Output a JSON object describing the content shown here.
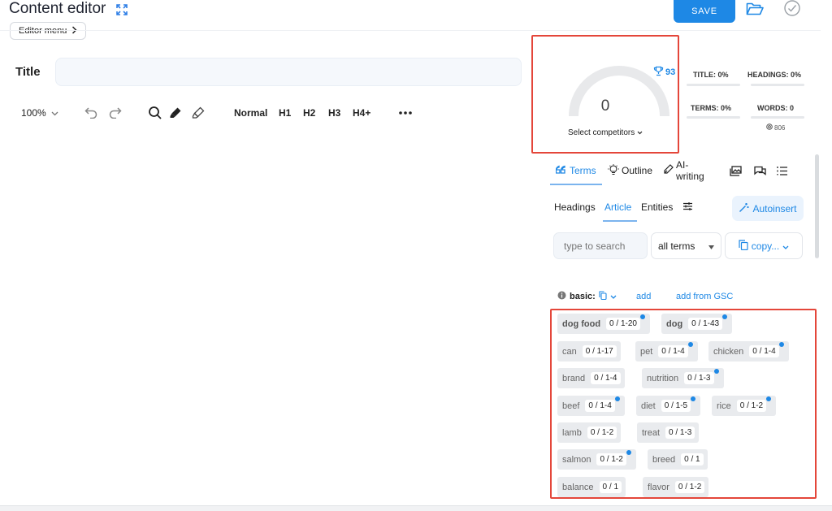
{
  "header": {
    "title": "Content editor",
    "editor_menu": "Editor menu",
    "save_label": "SAVE"
  },
  "editor": {
    "title_label": "Title",
    "title_value": "",
    "zoom": "100%",
    "formats": [
      "Normal",
      "H1",
      "H2",
      "H3",
      "H4+"
    ]
  },
  "score": {
    "value": "0",
    "select_competitors": "Select competitors",
    "target": "93",
    "metrics": {
      "title": "TITLE: 0%",
      "headings": "HEADINGS: 0%",
      "terms": "TERMS: 0%",
      "words": "WORDS: 0",
      "words_target": "806"
    }
  },
  "tabs": {
    "terms": "Terms",
    "outline": "Outline",
    "ai_writing": "AI-writing"
  },
  "subtabs": {
    "headings": "Headings",
    "article": "Article",
    "entities": "Entities",
    "autoinsert": "Autoinsert"
  },
  "filters": {
    "search_placeholder": "type to search",
    "terms_select": "all terms",
    "copy": "copy..."
  },
  "basic": {
    "label": "basic:",
    "add": "add",
    "add_gsc": "add from GSC"
  },
  "terms": [
    {
      "name": "dog food",
      "count": "0 / 1-20",
      "dot": true,
      "bold": true
    },
    {
      "name": "dog",
      "count": "0 / 1-43",
      "dot": true,
      "bold": true
    },
    {
      "name": "can",
      "count": "0 / 1-17",
      "dot": false,
      "bold": false
    },
    {
      "name": "pet",
      "count": "0 / 1-4",
      "dot": true,
      "bold": false
    },
    {
      "name": "chicken",
      "count": "0 / 1-4",
      "dot": true,
      "bold": false
    },
    {
      "name": "brand",
      "count": "0 / 1-4",
      "dot": false,
      "bold": false
    },
    {
      "name": "nutrition",
      "count": "0 / 1-3",
      "dot": true,
      "bold": false
    },
    {
      "name": "beef",
      "count": "0 / 1-4",
      "dot": true,
      "bold": false
    },
    {
      "name": "diet",
      "count": "0 / 1-5",
      "dot": true,
      "bold": false
    },
    {
      "name": "rice",
      "count": "0 / 1-2",
      "dot": true,
      "bold": false
    },
    {
      "name": "lamb",
      "count": "0 / 1-2",
      "dot": false,
      "bold": false
    },
    {
      "name": "treat",
      "count": "0 / 1-3",
      "dot": false,
      "bold": false
    },
    {
      "name": "salmon",
      "count": "0 / 1-2",
      "dot": true,
      "bold": false
    },
    {
      "name": "breed",
      "count": "0 / 1",
      "dot": false,
      "bold": false
    },
    {
      "name": "balance",
      "count": "0 / 1",
      "dot": false,
      "bold": false
    },
    {
      "name": "flavor",
      "count": "0 / 1-2",
      "dot": false,
      "bold": false
    }
  ]
}
